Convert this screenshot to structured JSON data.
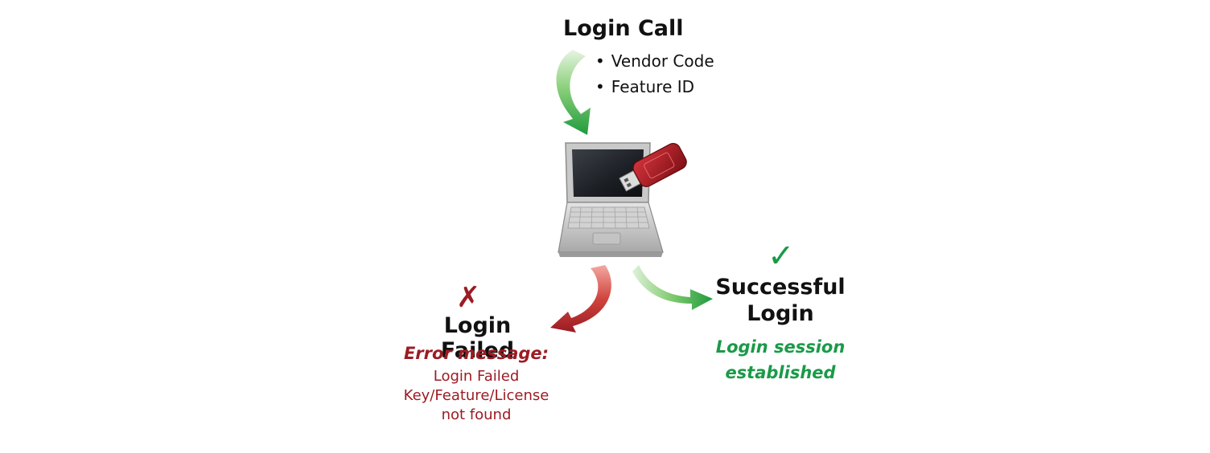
{
  "login_call": {
    "title": "Login Call",
    "bullets": [
      "Vendor Code",
      "Feature ID"
    ]
  },
  "failed": {
    "mark": "✗",
    "title": "Login Failed",
    "error_heading": "Error message:",
    "error_lines": [
      "Login Failed",
      "Key/Feature/License",
      "not found"
    ]
  },
  "success": {
    "mark": "✓",
    "title_lines": [
      "Successful",
      "Login"
    ],
    "subtitle_lines": [
      "Login session",
      "established"
    ]
  },
  "colors": {
    "failure": "#9b1c24",
    "success": "#1a9a48",
    "arrow_green": "#2aa34a",
    "arrow_red": "#a5212a",
    "dongle": "#b3141e"
  },
  "icons": {
    "device": "laptop-icon",
    "key": "usb-dongle-icon"
  }
}
